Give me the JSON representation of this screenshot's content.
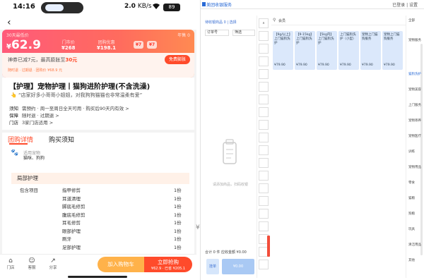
{
  "status_bar": {
    "time": "14:16",
    "speed": "2.0",
    "speed_unit": "KB/s",
    "battery": "89"
  },
  "price_card": {
    "top_left": "30天最低价",
    "top_right": "年售 0",
    "yen": "¥",
    "price": "62.9",
    "col1_label": "门市价",
    "col1_value": "¥268",
    "col2_label": "团购优惠",
    "col2_value": "¥198.1",
    "tag1": "¥7",
    "tag2": "¥7",
    "sub_text_prefix": "神券已减7元，最高膨胀至",
    "sub_text_highlight": "30元",
    "sub_button": "免费膨胀",
    "sub_line": "随时退 · 过期退 · 团购价 ¥68.9 元"
  },
  "title_box": {
    "title": "【护理】宠物护理丨猫狗进阶护理(不含洗澡)",
    "quote": "“店家好多小哥哥小姐姐，对我狗狗猫猫也非常温柔有爱”",
    "rows": [
      {
        "label": "须知",
        "text": "需预约 · 周一至周日全天可用 · 购买后90天内有效 >"
      },
      {
        "label": "保障",
        "text": "随时退 · 过期退 >"
      },
      {
        "label": "门店",
        "text": "3家门店适用 >"
      }
    ]
  },
  "tabs": {
    "active": "团购详情",
    "other": "购买须知"
  },
  "detail": {
    "pet_label": "适用宠物",
    "pet_value": "猫咪、狗狗",
    "section": "局部护理",
    "items": [
      {
        "c1": "包含项目",
        "c2": "指甲修剪",
        "c3": "1份"
      },
      {
        "c1": "",
        "c2": "耳道清理",
        "c3": "1份"
      },
      {
        "c1": "",
        "c2": "脚底毛修剪",
        "c3": "1份"
      },
      {
        "c1": "",
        "c2": "腹底毛修剪",
        "c3": "1份"
      },
      {
        "c1": "",
        "c2": "耳毛修剪",
        "c3": "1份"
      },
      {
        "c1": "",
        "c2": "眼部护理",
        "c3": "1份"
      },
      {
        "c1": "",
        "c2": "刷牙",
        "c3": "1份"
      },
      {
        "c1": "",
        "c2": "足部护理",
        "c3": "1份"
      }
    ]
  },
  "bottom_bar": {
    "store_label": "门店",
    "service_label": "客服",
    "share_label": "分享",
    "cart_button": "加入购物车",
    "buy_button": "立即抢购",
    "buy_sub": "¥62.9 · 已省 ¥205.1"
  },
  "app": {
    "title": "美团收银服务",
    "title_right": "已登录 | 设置",
    "panel1": {
      "head": "待收银商品 0  |  选择",
      "drop1": "订单号",
      "drop2": "筛选",
      "empty_text": "请添加商品，扫码收银",
      "summary": "合计 0 件  应收金额 ¥0.00",
      "btn_a": "挂单",
      "btn_b": "¥0.00"
    },
    "panel2_buttons": [
      "∧",
      "",
      "",
      "",
      "",
      "",
      "",
      "",
      "",
      "",
      "",
      "",
      "",
      "",
      "",
      "",
      "",
      "",
      "",
      "",
      "",
      "",
      ""
    ],
    "panel3": {
      "search": "会员",
      "cards": [
        {
          "name": "【9g/以上】上门猫狗洗护",
          "price": "¥79.90"
        },
        {
          "name": "【9-15kg】上门猫狗洗护",
          "price": "¥79.90"
        },
        {
          "name": "【5kg内】上门猫狗洗护",
          "price": "¥79.90"
        },
        {
          "name": "上门猫狗洗护（小型）",
          "price": "¥79.90"
        },
        {
          "name": "宠物上门猫狗服务",
          "price": "¥79.90"
        },
        {
          "name": "宠物上门猫狗服务",
          "price": "¥79.90"
        }
      ]
    },
    "panel4_items": [
      "全部",
      "宠物服务",
      "猫狗洗护",
      "宠物美容",
      "上门服务",
      "宠物寄养",
      "宠物医疗",
      "训练",
      "宠物用品",
      "零食",
      "猫粮",
      "狗粮",
      "玩具",
      "清洁用品",
      "其他"
    ]
  }
}
